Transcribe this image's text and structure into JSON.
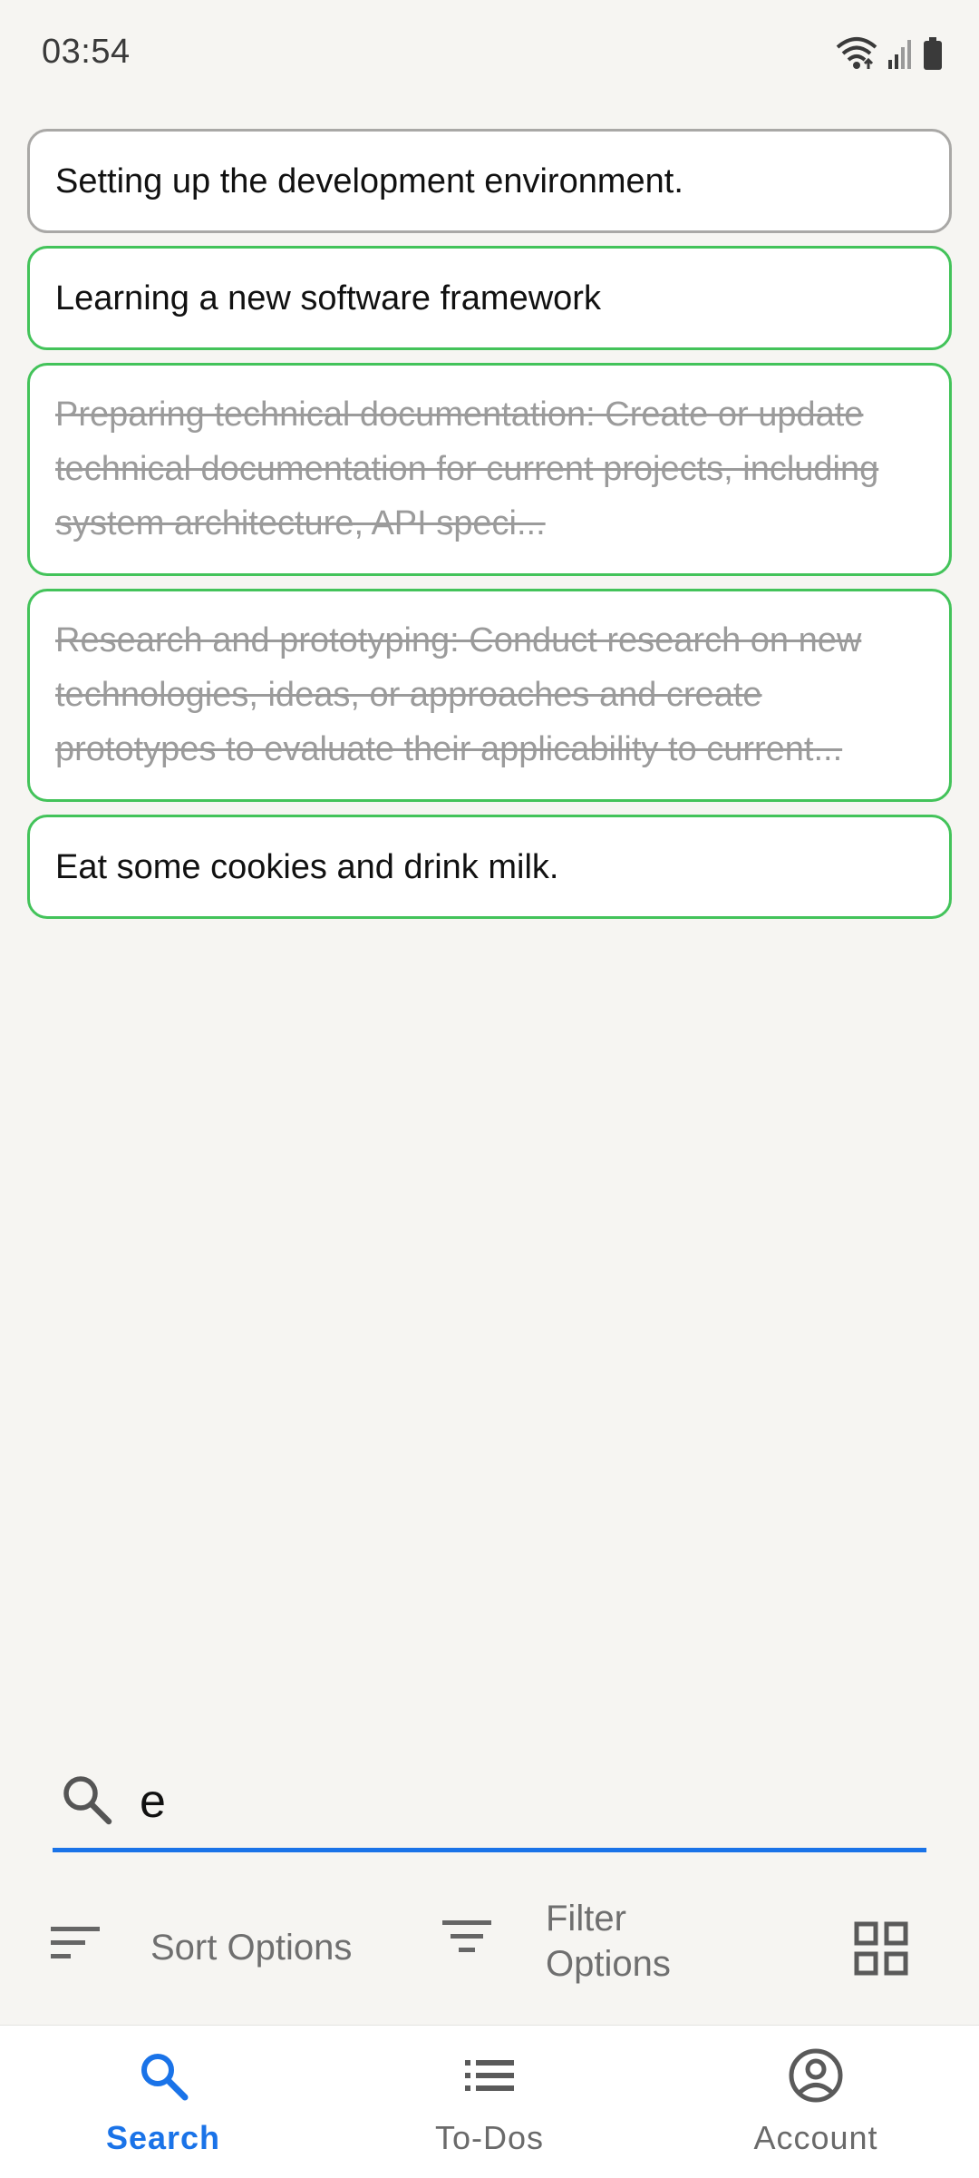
{
  "status_bar": {
    "time": "03:54",
    "icons": [
      "wifi-icon",
      "signal-icon",
      "battery-icon"
    ]
  },
  "todos": [
    {
      "text": "Setting up the development environment.",
      "done": false,
      "selected": true
    },
    {
      "text": "Learning a new software framework",
      "done": false,
      "selected": false
    },
    {
      "text": "Preparing technical documentation: Create or update technical documentation for current projects, including system architecture, API speci...",
      "done": true,
      "selected": false
    },
    {
      "text": "Research and prototyping: Conduct research on new technologies, ideas, or approaches and create prototypes to evaluate their applicability to current...",
      "done": true,
      "selected": false
    },
    {
      "text": "Eat some cookies and drink milk.",
      "done": false,
      "selected": false
    }
  ],
  "search": {
    "value": "e",
    "icon": "search-icon"
  },
  "options": {
    "sort_label": "Sort Options",
    "filter_label": "Filter Options",
    "grid_icon": "grid-view-icon"
  },
  "nav": {
    "items": [
      {
        "label": "Search",
        "icon": "search-icon",
        "active": true
      },
      {
        "label": "To-Dos",
        "icon": "list-icon",
        "active": false
      },
      {
        "label": "Account",
        "icon": "account-circle-icon",
        "active": false
      }
    ]
  },
  "colors": {
    "accent": "#1a73e8",
    "card_border": "#43c35a",
    "selected_border": "#a9a8a6",
    "background": "#f6f5f2"
  }
}
